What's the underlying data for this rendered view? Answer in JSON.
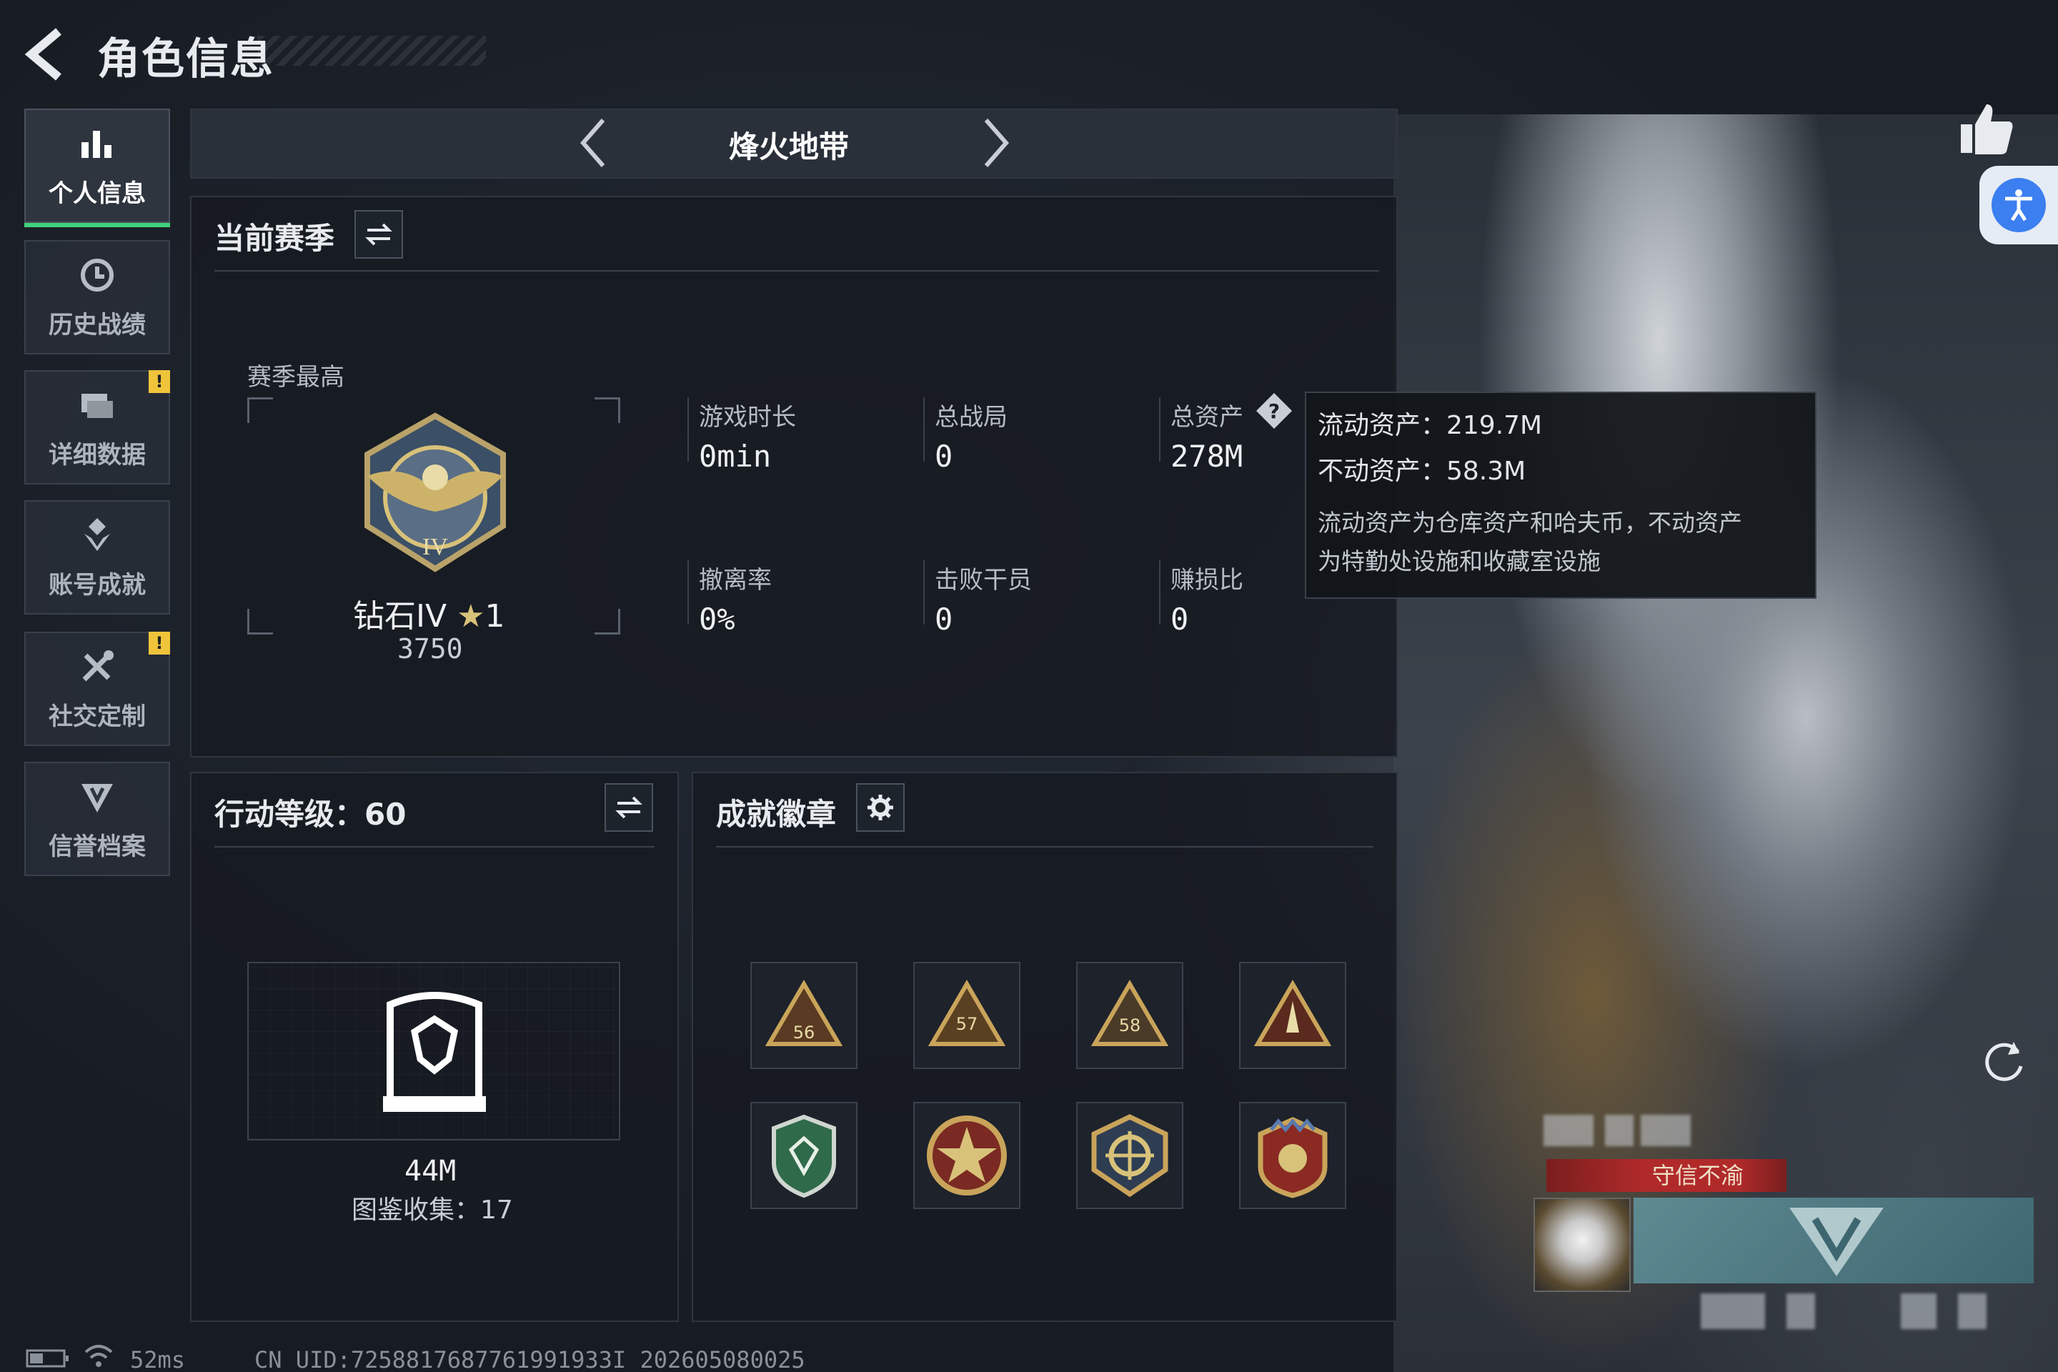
{
  "header": {
    "title": "角色信息"
  },
  "sidebar": {
    "items": [
      {
        "label": "个人信息",
        "icon": "bar-chart-icon",
        "active": true
      },
      {
        "label": "历史战绩",
        "icon": "history-icon",
        "active": false
      },
      {
        "label": "详细数据",
        "icon": "folder-icon",
        "active": false,
        "alert": "!"
      },
      {
        "label": "账号成就",
        "icon": "achievement-icon",
        "active": false
      },
      {
        "label": "社交定制",
        "icon": "tools-icon",
        "active": false,
        "alert": "!"
      },
      {
        "label": "信誉档案",
        "icon": "credit-icon",
        "active": false
      }
    ]
  },
  "mode": {
    "title": "烽火地带"
  },
  "season": {
    "title": "当前赛季",
    "best_label": "赛季最高",
    "rank_name": "钻石IV",
    "rank_stars": "1",
    "rank_points": "3750",
    "stats": [
      {
        "label": "游戏时长",
        "value": "0min"
      },
      {
        "label": "总战局",
        "value": "0"
      },
      {
        "label": "总资产",
        "value": "278M"
      },
      {
        "label": "撤离率",
        "value": "0%"
      },
      {
        "label": "击败干员",
        "value": "0"
      },
      {
        "label": "赚损比",
        "value": "0"
      }
    ]
  },
  "tooltip": {
    "liquid": "流动资产：219.7M",
    "fixed": "不动资产：58.3M",
    "note_line1": "流动资产为仓库资产和哈夫币，不动资产",
    "note_line2": "为特勤处设施和收藏室设施"
  },
  "action_level": {
    "title": "行动等级：60",
    "collection_value": "44M",
    "collection_label": "图鉴收集：17"
  },
  "achievements": {
    "title": "成就徽章",
    "badges": [
      "56",
      "57",
      "58",
      "",
      "",
      "",
      "",
      ""
    ]
  },
  "profile": {
    "honor_tag": "守信不渝"
  },
  "footer": {
    "ping": "52ms",
    "uid": "CN UID:7258817687761991933I_202605080025"
  },
  "colors": {
    "accent_green": "#3fd17a",
    "alert_yellow": "#f0c43a",
    "honor_red": "#b02a2a",
    "access_blue": "#3b7ff0"
  }
}
